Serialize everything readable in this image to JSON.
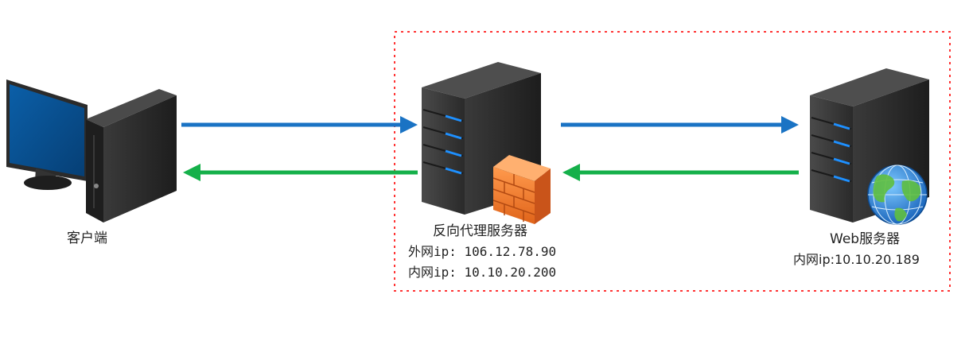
{
  "client": {
    "label": "客户端",
    "icon": "desktop-computer-icon"
  },
  "proxy": {
    "label": "反向代理服务器",
    "external_ip": "外网ip: 106.12.78.90",
    "internal_ip": "内网ip: 10.10.20.200",
    "icon": "server-firewall-icon"
  },
  "web": {
    "label": "Web服务器",
    "internal_ip": "内网ip:10.10.20.189",
    "icon": "server-globe-icon"
  },
  "colors": {
    "request_arrow": "#1a73c4",
    "response_arrow": "#15b04a",
    "boundary": "#ff3333",
    "server_body": "#2e2e2e",
    "led": "#1e90ff"
  }
}
